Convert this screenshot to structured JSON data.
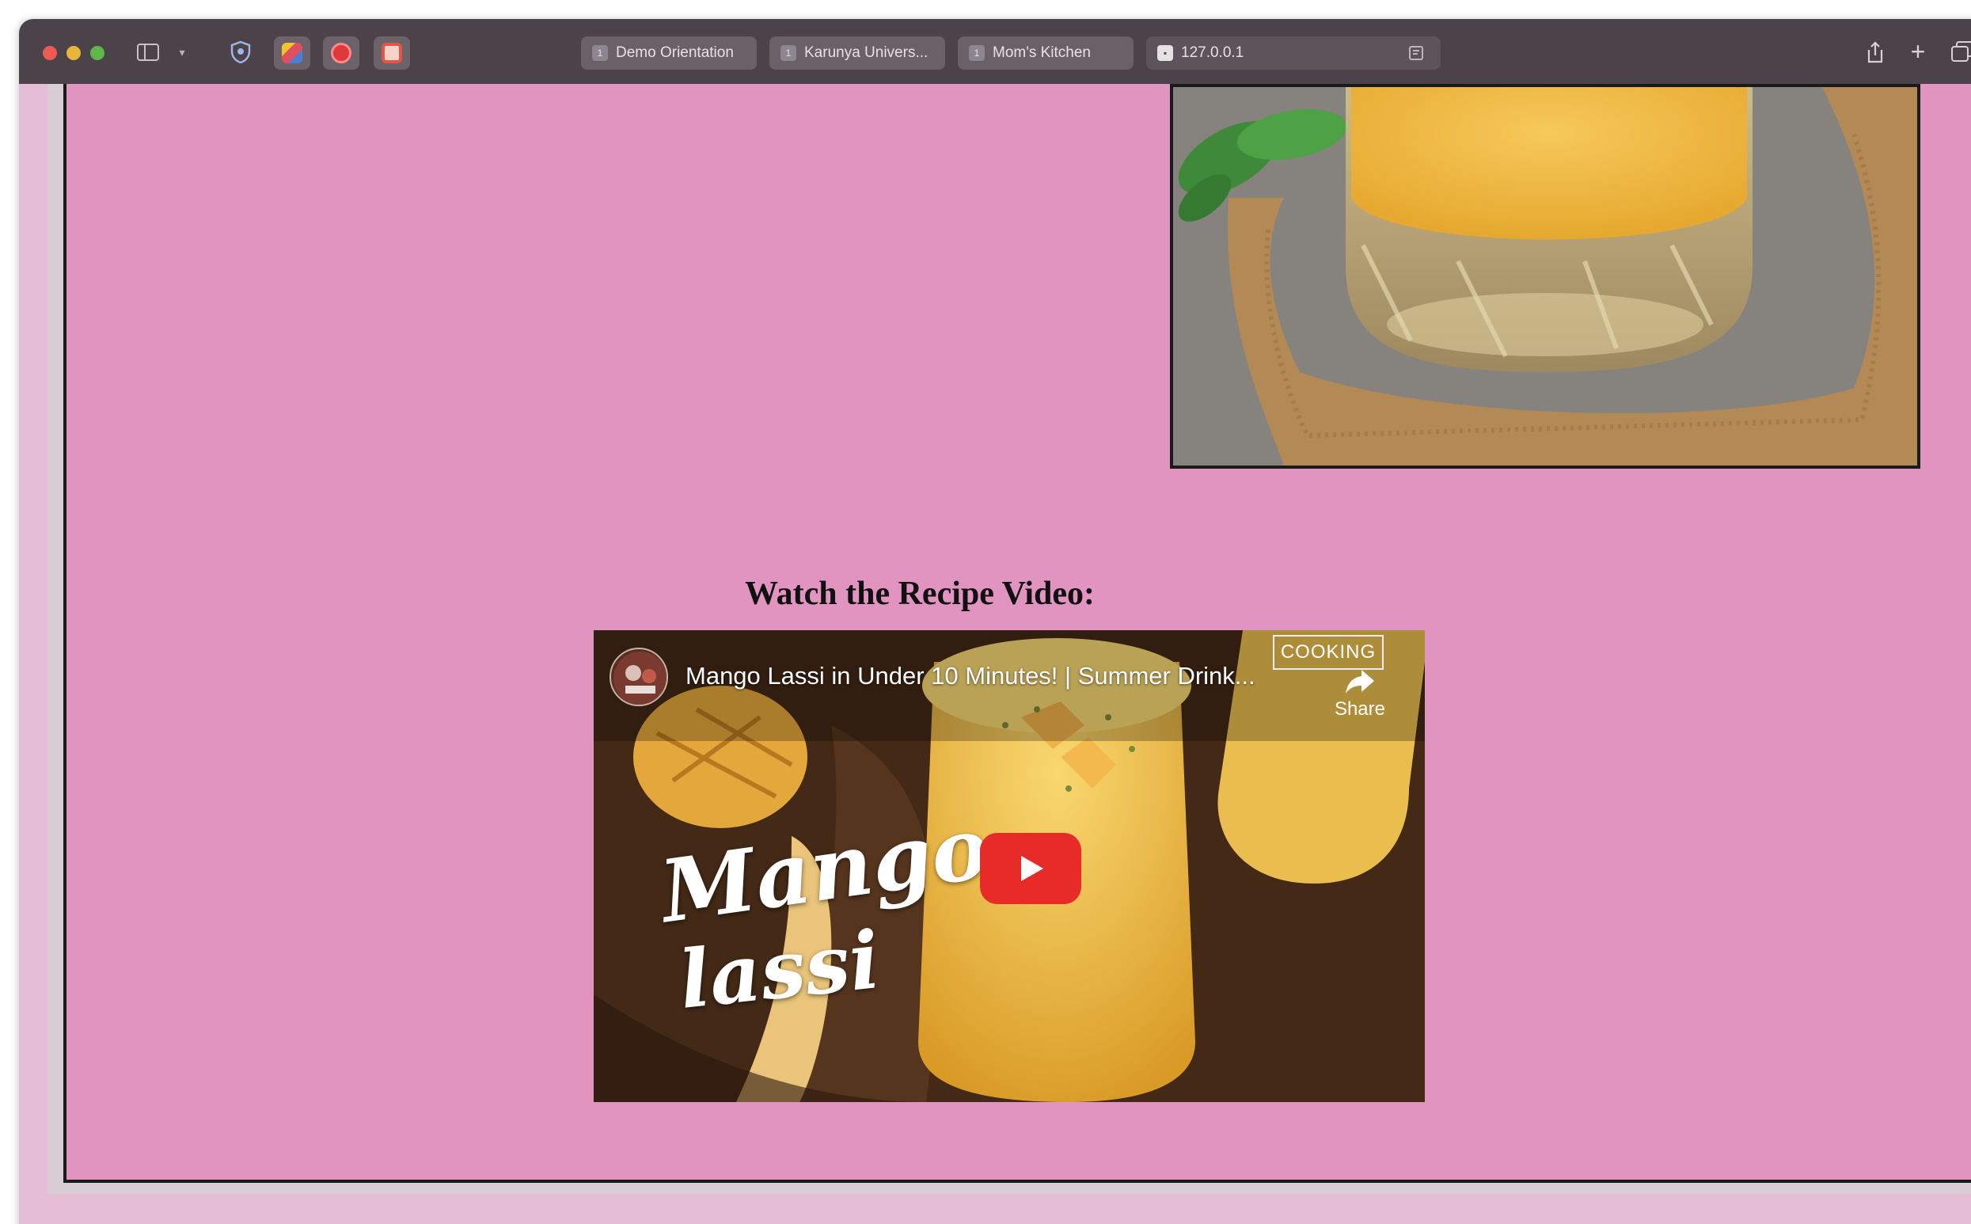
{
  "browser": {
    "tabs": [
      {
        "favicon": "1",
        "label": "Demo Orientation"
      },
      {
        "favicon": "1",
        "label": "Karunya Univers..."
      },
      {
        "favicon": "1",
        "label": "Mom's Kitchen"
      }
    ],
    "active_tab": {
      "label": "127.0.0.1"
    },
    "icons": [
      "sidebar-icon",
      "shield-icon",
      "share-icon",
      "plus-icon",
      "tabs-icon"
    ],
    "colors": {
      "toolbar": "#4b424a",
      "page_background": "#e294c1",
      "outer_background": "#e4bcd6"
    }
  },
  "page": {
    "video_heading": "Watch the Recipe Video:",
    "video": {
      "title": "Mango Lassi in Under 10 Minutes! | Summer Drink...",
      "share_label": "Share",
      "channel_logo_text": "COOKING",
      "overlay_line1": "Mango",
      "overlay_line2": "lassi"
    }
  }
}
